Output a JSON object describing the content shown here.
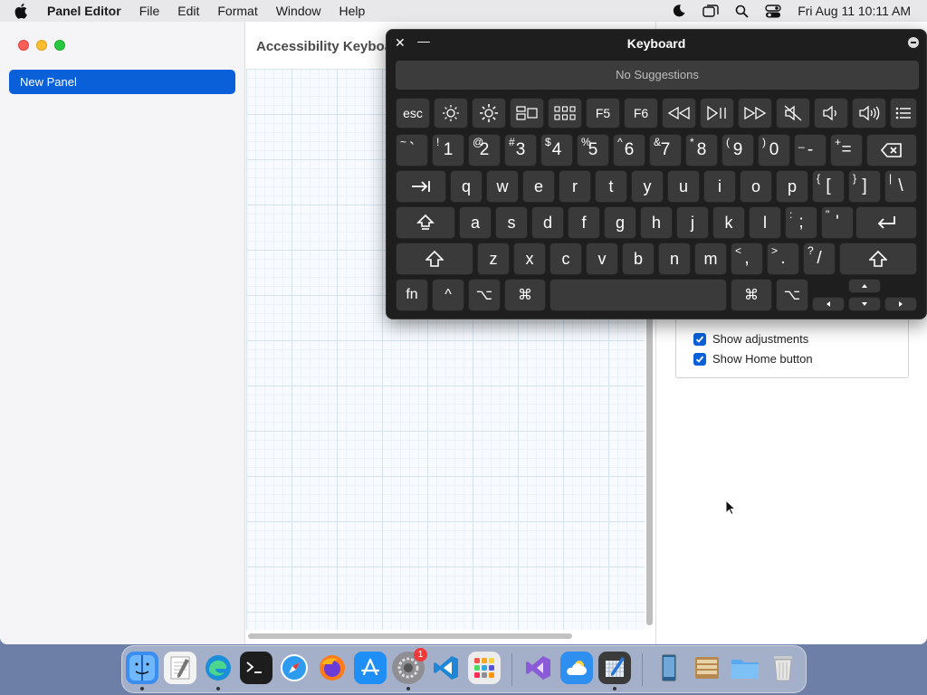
{
  "menubar": {
    "app_name": "Panel Editor",
    "items": [
      "File",
      "Edit",
      "Format",
      "Window",
      "Help"
    ],
    "clock": "Fri Aug 11  10:11 AM"
  },
  "sidebar": {
    "items": [
      {
        "label": "New Panel",
        "selected": true
      }
    ]
  },
  "content": {
    "title": "Accessibility Keyboa"
  },
  "options": {
    "show_adjustments": "Show adjustments",
    "show_home_button": "Show Home button"
  },
  "keyboard": {
    "title": "Keyboard",
    "suggestions": "No Suggestions",
    "keys": {
      "esc": "esc",
      "f5": "F5",
      "f6": "F6",
      "row2": [
        {
          "sym": "~",
          "main": "`"
        },
        {
          "sym": "!",
          "main": "1"
        },
        {
          "sym": "@",
          "main": "2"
        },
        {
          "sym": "#",
          "main": "3"
        },
        {
          "sym": "$",
          "main": "4"
        },
        {
          "sym": "%",
          "main": "5"
        },
        {
          "sym": "^",
          "main": "6"
        },
        {
          "sym": "&",
          "main": "7"
        },
        {
          "sym": "*",
          "main": "8"
        },
        {
          "sym": "(",
          "main": "9"
        },
        {
          "sym": ")",
          "main": "0"
        },
        {
          "sym": "_",
          "main": "-"
        },
        {
          "sym": "+",
          "main": "="
        }
      ],
      "row3": [
        "q",
        "w",
        "e",
        "r",
        "t",
        "y",
        "u",
        "i",
        "o",
        "p"
      ],
      "row3_sym": [
        {
          "sym": "{",
          "main": "["
        },
        {
          "sym": "}",
          "main": "]"
        },
        {
          "sym": "|",
          "main": "\\"
        }
      ],
      "row4": [
        "a",
        "s",
        "d",
        "f",
        "g",
        "h",
        "j",
        "k",
        "l"
      ],
      "row4_sym": [
        {
          "sym": ":",
          "main": ";"
        },
        {
          "sym": "\"",
          "main": "'"
        }
      ],
      "row5": [
        "z",
        "x",
        "c",
        "v",
        "b",
        "n",
        "m"
      ],
      "row5_sym": [
        {
          "sym": "<",
          "main": ","
        },
        {
          "sym": ">",
          "main": "."
        },
        {
          "sym": "?",
          "main": "/"
        }
      ],
      "fn": "fn",
      "control": "^",
      "option": "⌥",
      "command": "⌘"
    }
  },
  "dock": {
    "badge_count": "1"
  },
  "colors": {
    "accent": "#0a60d9",
    "keyboard_bg": "#1e1e1e",
    "key_bg": "#3a3a3a"
  }
}
